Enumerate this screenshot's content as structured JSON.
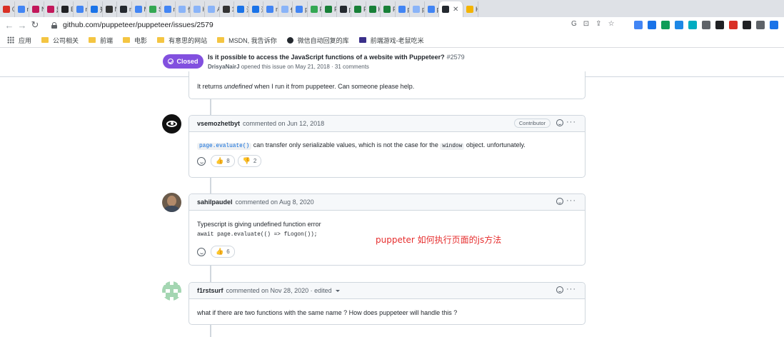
{
  "browser": {
    "tabs": [
      {
        "label": "01",
        "color": "#d93025"
      },
      {
        "label": "ne",
        "color": "#4285f4"
      },
      {
        "label": "N",
        "color": "#c2185b"
      },
      {
        "label": "异",
        "color": "#c2185b"
      },
      {
        "label": "Ex",
        "color": "#202124"
      },
      {
        "label": "nc",
        "color": "#4285f4"
      },
      {
        "label": "知",
        "color": "#1a73e8"
      },
      {
        "label": "N",
        "color": "#333333"
      },
      {
        "label": "ne",
        "color": "#24292f"
      },
      {
        "label": "M",
        "color": "#4285f4"
      },
      {
        "label": "Sa",
        "color": "#34a853"
      },
      {
        "label": "m",
        "color": "#4285f4"
      },
      {
        "label": "快",
        "color": "#8ab4f8"
      },
      {
        "label": "H",
        "color": "#8ab4f8"
      },
      {
        "label": "A",
        "color": "#8ab4f8"
      },
      {
        "label": "1(",
        "color": "#333333"
      },
      {
        "label": "深",
        "color": "#1a73e8"
      },
      {
        "label": "深",
        "color": "#1a73e8"
      },
      {
        "label": "m",
        "color": "#4285f4"
      },
      {
        "label": "任",
        "color": "#8ab4f8"
      },
      {
        "label": "pu",
        "color": "#4285f4"
      },
      {
        "label": "Pu",
        "color": "#34a853"
      },
      {
        "label": "Pu",
        "color": "#188038"
      },
      {
        "label": "pu",
        "color": "#24292f"
      },
      {
        "label": "Pu",
        "color": "#188038"
      },
      {
        "label": "H",
        "color": "#188038"
      },
      {
        "label": "Pu",
        "color": "#188038"
      },
      {
        "label": "pu",
        "color": "#4285f4"
      },
      {
        "label": "pu",
        "color": "#8ab4f8"
      },
      {
        "label": "pu",
        "color": "#4285f4"
      }
    ],
    "active_tab_close": "✕",
    "extra_tab": {
      "label": "H",
      "color": "#f4b400"
    },
    "back_icon": "←",
    "forward_icon": "→",
    "reload_icon": "↻",
    "url": "github.com/puppeteer/puppeteer/issues/2579",
    "omnibox_icons": [
      "G",
      "⊡",
      "⇪",
      "☆"
    ],
    "extensions": [
      "#4285f4",
      "#1a73e8",
      "#0f9d58",
      "#1e88e5",
      "#00acc1",
      "#5f6368",
      "#202124",
      "#d93025",
      "#202124",
      "#5f6368",
      "#1a73e8"
    ],
    "bookmarks": [
      {
        "label": "应用",
        "type": "apps"
      },
      {
        "label": "公司相关",
        "type": "folder"
      },
      {
        "label": "前端",
        "type": "folder"
      },
      {
        "label": "电影",
        "type": "folder"
      },
      {
        "label": "有意思的网站",
        "type": "folder"
      },
      {
        "label": "MSDN, 我告诉你",
        "type": "folder"
      },
      {
        "label": "微信自动回复的库",
        "type": "github"
      },
      {
        "label": "前端游戏-老鼠吃米",
        "type": "game"
      }
    ]
  },
  "issue": {
    "state": "Closed",
    "title": "Is it possible to access the JavaScript functions of a website with Puppeteer?",
    "number": "#2579",
    "author": "DrisyaNairJ",
    "meta": "opened this issue on May 21, 2018 · 31 comments"
  },
  "comments": [
    {
      "body_text": "It returns ",
      "body_em": "undefined",
      "body_text_after": " when I run it from puppeteer. Can someone please help."
    },
    {
      "author": "vsemozhetbyt",
      "action": "commented on Jun 12, 2018",
      "role": "Contributor",
      "code1": "page.evaluate()",
      "text1": " can transfer only serializable values, which is not the case for the ",
      "code2": "window",
      "text2": " object. unfortunately.",
      "reactions": [
        {
          "emoji": "👍",
          "count": "8"
        },
        {
          "emoji": "👎",
          "count": "2"
        }
      ]
    },
    {
      "author": "sahilpaudel",
      "action": "commented on Aug 8, 2020",
      "line1": "Typescript is giving undefined function error",
      "code": "await page.evaluate(() => fLogon());",
      "reactions": [
        {
          "emoji": "👍",
          "count": "6"
        }
      ]
    },
    {
      "author": "f1rstsurf",
      "action": "commented on Nov 28, 2020 · edited",
      "body": "what if there are two functions with the same name ? How does puppeteer will handle this ?"
    }
  ],
  "annotation": "puppeter 如何执行页面的js方法",
  "more_icon": "···"
}
